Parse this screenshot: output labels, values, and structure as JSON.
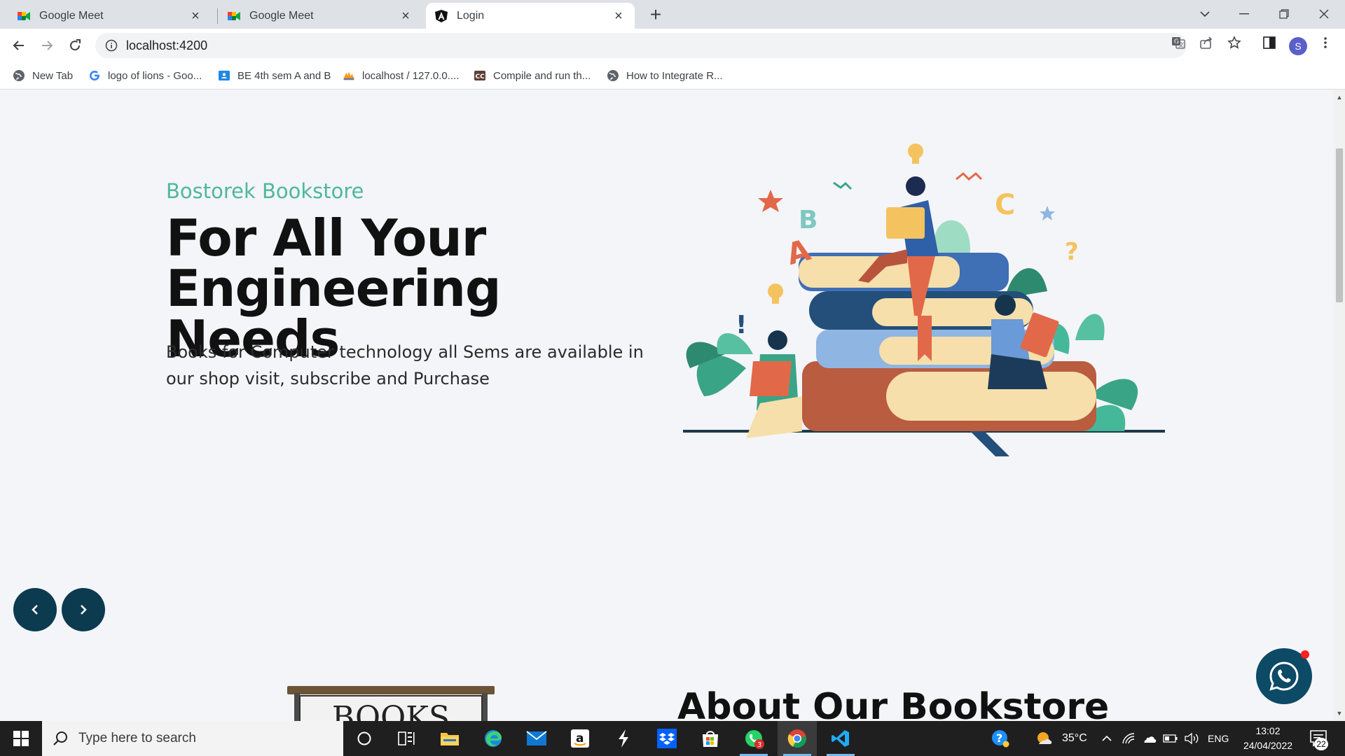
{
  "browser": {
    "tabs": [
      {
        "title": "Google Meet",
        "icon": "google-meet-icon"
      },
      {
        "title": "Google Meet",
        "icon": "google-meet-icon"
      },
      {
        "title": "Login",
        "icon": "angular-icon"
      }
    ],
    "url": "localhost:4200",
    "profile_initial": "S",
    "bookmarks": [
      {
        "label": "New Tab",
        "icon": "globe-icon"
      },
      {
        "label": "logo of lions - Goo...",
        "icon": "google-icon"
      },
      {
        "label": "BE 4th sem A and B",
        "icon": "classroom-icon"
      },
      {
        "label": "localhost / 127.0.0....",
        "icon": "phpmyadmin-icon"
      },
      {
        "label": "Compile and run th...",
        "icon": "cc-icon"
      },
      {
        "label": "How to Integrate R...",
        "icon": "globe-icon"
      }
    ]
  },
  "page": {
    "hero": {
      "subtitle": "Bostorek Bookstore",
      "title": "For All Your Engineering Needs",
      "description": "Books for Computer technology all Sems are available in our shop visit, subscribe and Purchase"
    },
    "slider": {
      "prev": "‹",
      "next": "›"
    },
    "about_heading": "About Our Bookstore",
    "books_sign": "BOOKS"
  },
  "taskbar": {
    "search_placeholder": "Type here to search",
    "weather": "35°C",
    "language": "ENG",
    "time": "13:02",
    "date": "24/04/2022",
    "notification_count": "22",
    "whatsapp_badge": "3"
  },
  "colors": {
    "accent_green": "#4fb89c",
    "dark_teal": "#0c3a4f",
    "page_bg": "#f4f5f8"
  }
}
